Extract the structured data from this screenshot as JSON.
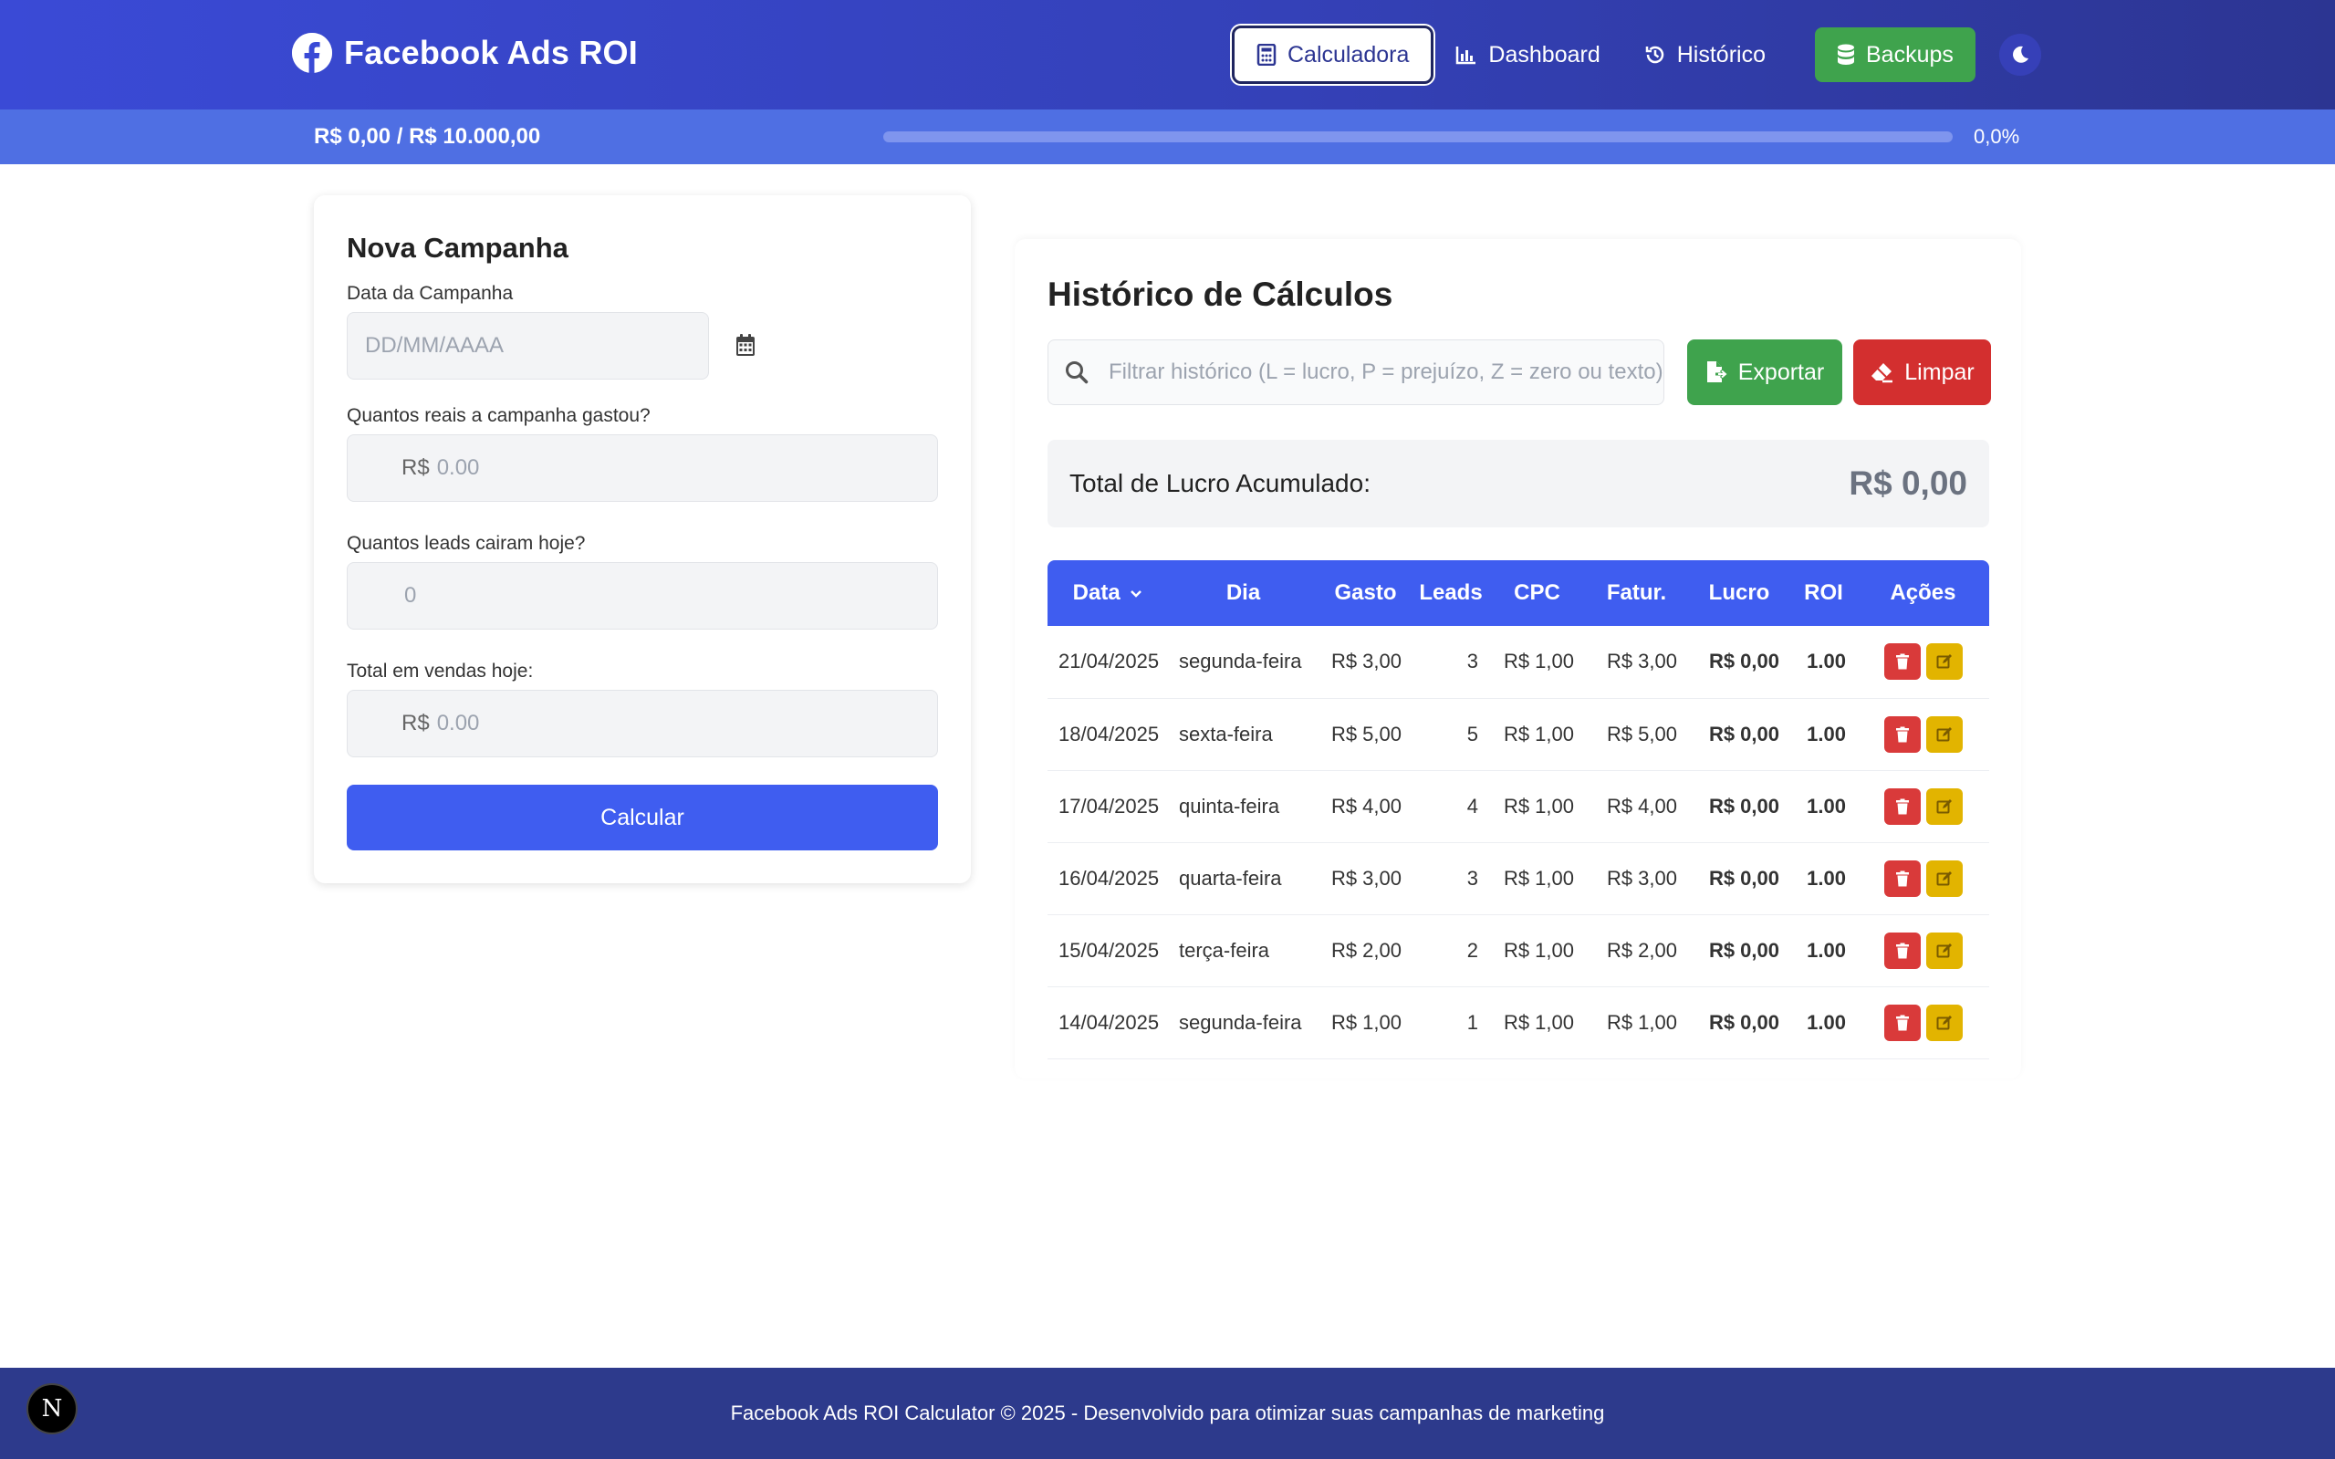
{
  "header": {
    "brand_title": "Facebook Ads ROI",
    "nav": {
      "calculadora": "Calculadora",
      "dashboard": "Dashboard",
      "historico": "Histórico",
      "backups": "Backups"
    }
  },
  "progress": {
    "label": "R$ 0,00 / R$ 10.000,00",
    "percent_text": "0,0%",
    "fraction": 0.0
  },
  "form": {
    "title": "Nova Campanha",
    "date_label": "Data da Campanha",
    "date_placeholder": "DD/MM/AAAA",
    "spent_label": "Quantos reais a campanha gastou?",
    "spent_prefix": "R$",
    "spent_placeholder": "0.00",
    "leads_label": "Quantos leads cairam hoje?",
    "leads_placeholder": "0",
    "sales_label": "Total em vendas hoje:",
    "sales_prefix": "R$",
    "sales_placeholder": "0.00",
    "submit_label": "Calcular"
  },
  "history": {
    "title": "Histórico de Cálculos",
    "search_placeholder": "Filtrar histórico (L = lucro, P = prejuízo, Z = zero ou texto)",
    "export_label": "Exportar",
    "clear_label": "Limpar",
    "total_label": "Total de Lucro Acumulado:",
    "total_value": "R$ 0,00",
    "columns": [
      "Data",
      "Dia",
      "Gasto",
      "Leads",
      "CPC",
      "Fatur.",
      "Lucro",
      "ROI",
      "Ações"
    ],
    "rows": [
      {
        "data": "21/04/2025",
        "dia": "segunda-feira",
        "gasto": "R$ 3,00",
        "leads": "3",
        "cpc": "R$ 1,00",
        "fatur": "R$ 3,00",
        "lucro": "R$ 0,00",
        "roi": "1.00"
      },
      {
        "data": "18/04/2025",
        "dia": "sexta-feira",
        "gasto": "R$ 5,00",
        "leads": "5",
        "cpc": "R$ 1,00",
        "fatur": "R$ 5,00",
        "lucro": "R$ 0,00",
        "roi": "1.00"
      },
      {
        "data": "17/04/2025",
        "dia": "quinta-feira",
        "gasto": "R$ 4,00",
        "leads": "4",
        "cpc": "R$ 1,00",
        "fatur": "R$ 4,00",
        "lucro": "R$ 0,00",
        "roi": "1.00"
      },
      {
        "data": "16/04/2025",
        "dia": "quarta-feira",
        "gasto": "R$ 3,00",
        "leads": "3",
        "cpc": "R$ 1,00",
        "fatur": "R$ 3,00",
        "lucro": "R$ 0,00",
        "roi": "1.00"
      },
      {
        "data": "15/04/2025",
        "dia": "terça-feira",
        "gasto": "R$ 2,00",
        "leads": "2",
        "cpc": "R$ 1,00",
        "fatur": "R$ 2,00",
        "lucro": "R$ 0,00",
        "roi": "1.00"
      },
      {
        "data": "14/04/2025",
        "dia": "segunda-feira",
        "gasto": "R$ 1,00",
        "leads": "1",
        "cpc": "R$ 1,00",
        "fatur": "R$ 1,00",
        "lucro": "R$ 0,00",
        "roi": "1.00"
      }
    ]
  },
  "footer": {
    "text": "Facebook Ads ROI Calculator © 2025 - Desenvolvido para otimizar suas campanhas de marketing",
    "badge": "N"
  },
  "colors": {
    "primary": "#3f5df0",
    "success": "#3fa34d",
    "danger": "#d32f2f",
    "warning": "#e2b400",
    "footer": "#2d3a8c"
  },
  "icons": {
    "brand": "facebook-icon",
    "calculadora": "calculator-icon",
    "dashboard": "bar-chart-icon",
    "historico": "history-icon",
    "backups": "database-icon",
    "theme": "moon-icon",
    "date": "calendar-icon",
    "search": "search-icon",
    "export": "file-export-icon",
    "clear": "eraser-icon",
    "sort": "chevron-down-icon",
    "delete": "trash-icon",
    "edit": "edit-icon"
  }
}
